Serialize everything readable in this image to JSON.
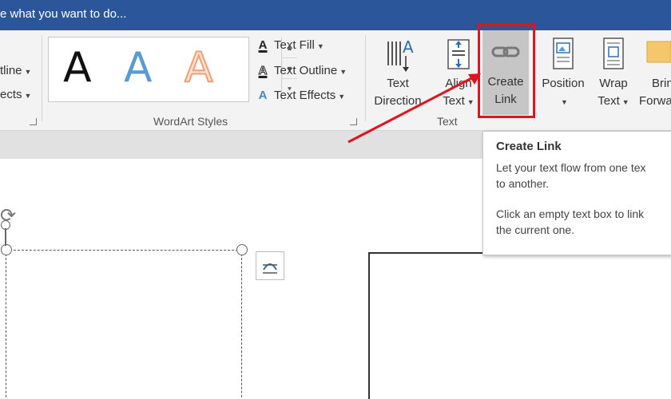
{
  "titlebar": {
    "tell_me": "e what you want to do..."
  },
  "ribbon": {
    "left_items": [
      "tline",
      "ects"
    ],
    "wordart": {
      "group_label": "WordArt Styles",
      "samples": [
        "A",
        "A",
        "A"
      ],
      "text_fill": "Text Fill",
      "text_outline": "Text Outline",
      "text_effects": "Text Effects"
    },
    "text_group": {
      "group_label": "Text",
      "text_direction": [
        "Text",
        "Direction"
      ],
      "align_text": [
        "Align",
        "Text"
      ],
      "create_link": [
        "Create",
        "Link"
      ]
    },
    "arrange": {
      "position": "Position",
      "wrap_text": [
        "Wrap",
        "Text"
      ],
      "bring_forward": [
        "Brin",
        "Forwa"
      ]
    }
  },
  "tooltip": {
    "title": "Create Link",
    "line1": "Let your text flow from one tex",
    "line2": "to another.",
    "line3": "Click an empty text box to link",
    "line4": "the current one."
  },
  "colors": {
    "title_bar": "#2b579a",
    "highlight": "#e0141c",
    "wordart_blue": "#5b9bd5",
    "wordart_orange": "#f0a070"
  }
}
